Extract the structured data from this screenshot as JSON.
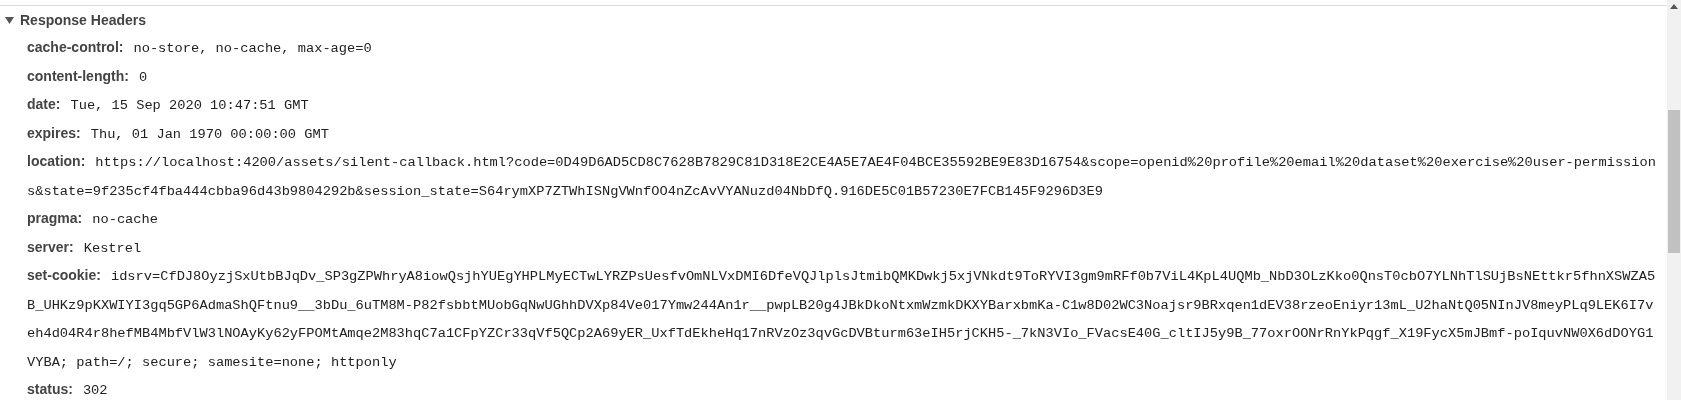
{
  "section": {
    "title": "Response Headers",
    "expanded": true
  },
  "headers": [
    {
      "name": "cache-control:",
      "lines": [
        "no-store, no-cache, max-age=0"
      ]
    },
    {
      "name": "content-length:",
      "lines": [
        "0"
      ]
    },
    {
      "name": "date:",
      "lines": [
        "Tue, 15 Sep 2020 10:47:51 GMT"
      ]
    },
    {
      "name": "expires:",
      "lines": [
        "Thu, 01 Jan 1970 00:00:00 GMT"
      ]
    },
    {
      "name": "location:",
      "lines": [
        "https://localhost:4200/assets/silent-callback.html?code=0D49D6AD5CD8C7628B7829C81D318E2CE4A5E7AE4F04BCE35592BE9E83D16754&scope=openid%20profile%20email%20dataset%20exercise%20user-permission",
        "s&state=9f235cf4fba444cbba96d43b9804292b&session_state=S64rymXP7ZTWhISNgVWnfOO4nZcAvVYANuzd04NbDfQ.916DE5C01B57230E7FCB145F9296D3E9"
      ]
    },
    {
      "name": "pragma:",
      "lines": [
        "no-cache"
      ]
    },
    {
      "name": "server:",
      "lines": [
        "Kestrel"
      ]
    },
    {
      "name": "set-cookie:",
      "lines": [
        "idsrv=CfDJ8OyzjSxUtbBJqDv_SP3gZPWhryA8iowQsjhYUEgYHPLMyECTwLYRZPsUesfvOmNLVxDMI6DfeVQJlplsJtmibQMKDwkj5xjVNkdt9ToRYVI3gm9mRFf0b7ViL4KpL4UQMb_NbD3OLzKko0QnsT0cbO7YLNhTlSUjBsNEttkr5fhnXSWZA5",
        "B_UHKz9pKXWIYI3gq5GP6AdmaShQFtnu9__3bDu_6uTM8M-P82fsbbtMUobGqNwUGhhDVXp84Ve017Ymw244An1r__pwpLB20g4JBkDkoNtxmWzmkDKXYBarxbmKa-C1w8D02WC3Noajsr9BRxqen1dEV38rzeoEniyr13mL_U2haNtQ05NInJV8meyPLq9LEK6I7v",
        "eh4d04R4r8hefMB4MbfVlW3lNOAyKy62yFPOMtAmqe2M83hqC7a1CFpYZCr33qVf5QCp2A69yER_UxfTdEkheHq17nRVzOz3qvGcDVBturm63eIH5rjCKH5-_7kN3VIo_FVacsE40G_cltIJ5y9B_77oxrOONrRnYkPqgf_X19FycX5mJBmf-poIquvNW0X6dDOYG1",
        "VYBA; path=/; secure; samesite=none; httponly"
      ]
    },
    {
      "name": "status:",
      "lines": [
        "302"
      ]
    }
  ]
}
